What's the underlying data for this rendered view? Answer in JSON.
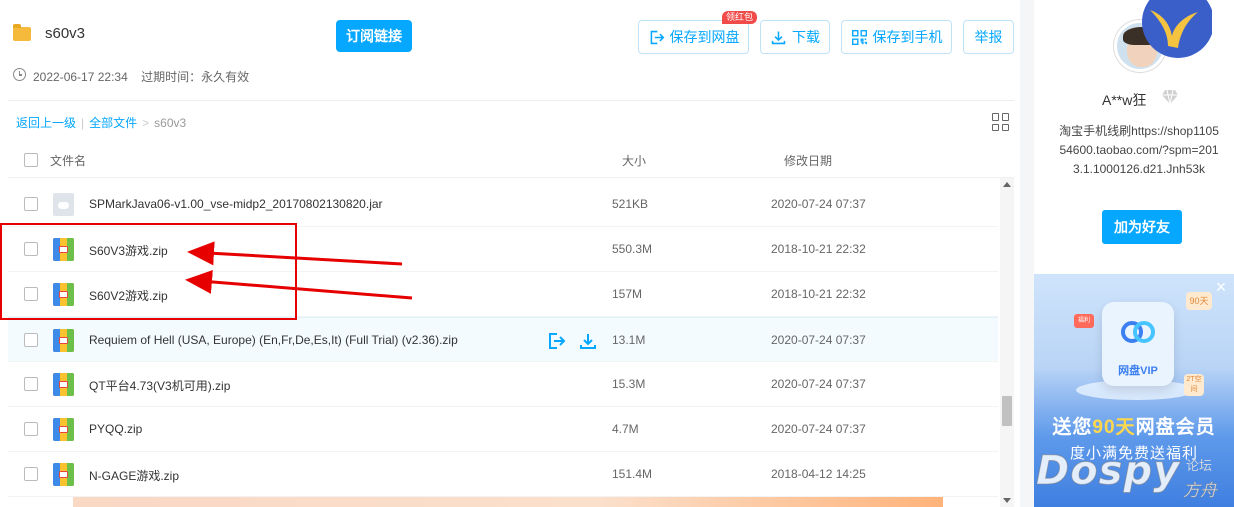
{
  "header": {
    "folder_name": "s60v3",
    "subscribe_label": "订阅链接",
    "save_to_disk_label": "保存到网盘",
    "red_packet_badge": "领红包",
    "download_label": "下载",
    "save_to_phone_label": "保存到手机",
    "report_label": "举报",
    "share_date": "2022-06-17 22:34",
    "expiry": "过期时间：永久有效"
  },
  "breadcrumb": {
    "back": "返回上一级",
    "all_files": "全部文件",
    "separator": ">",
    "current": "s60v3"
  },
  "columns": {
    "name": "文件名",
    "size": "大小",
    "modified": "修改日期"
  },
  "files": [
    {
      "name": "SPMarkJava06-v1.00_vse-midp2_20170802130820.jar",
      "size": "521KB",
      "date": "2020-07-24 07:37",
      "icon": "jar-file-icon"
    },
    {
      "name": "S60V3游戏.zip",
      "size": "550.3M",
      "date": "2018-10-21 22:32",
      "icon": "zip-file-icon"
    },
    {
      "name": "S60V2游戏.zip",
      "size": "157M",
      "date": "2018-10-21 22:32",
      "icon": "zip-file-icon"
    },
    {
      "name": "Requiem of Hell (USA, Europe) (En,Fr,De,Es,It) (Full Trial) (v2.36).zip",
      "size": "13.1M",
      "date": "2020-07-24 07:37",
      "icon": "zip-file-icon"
    },
    {
      "name": "QT平台4.73(V3机可用).zip",
      "size": "15.3M",
      "date": "2020-07-24 07:37",
      "icon": "zip-file-icon"
    },
    {
      "name": "PYQQ.zip",
      "size": "4.7M",
      "date": "2020-07-24 07:37",
      "icon": "zip-file-icon"
    },
    {
      "name": "N-GAGE游戏.zip",
      "size": "151.4M",
      "date": "2018-04-12 14:25",
      "icon": "zip-file-icon"
    }
  ],
  "sidebar": {
    "username": "A**w狂",
    "description": "淘宝手机线刷https://shop110554600.taobao.com/?spm=2013.1.1000126.d21.Jnh53k",
    "add_friend_label": "加为好友"
  },
  "ad": {
    "badge_days": "90天",
    "card_label": "网盘VIP",
    "space_badge": "2T空间",
    "gift_badge": "福利",
    "title_prefix": "送您",
    "title_highlight": "90天",
    "title_suffix": "网盘会员",
    "subtitle": "度小满免费送福利"
  },
  "watermark": {
    "brand": "Dospy",
    "tag1": "论坛",
    "tag2": "方舟"
  },
  "colors": {
    "accent": "#06a7ff",
    "annotation": "#e60000",
    "badge_red": "#f04a49"
  }
}
